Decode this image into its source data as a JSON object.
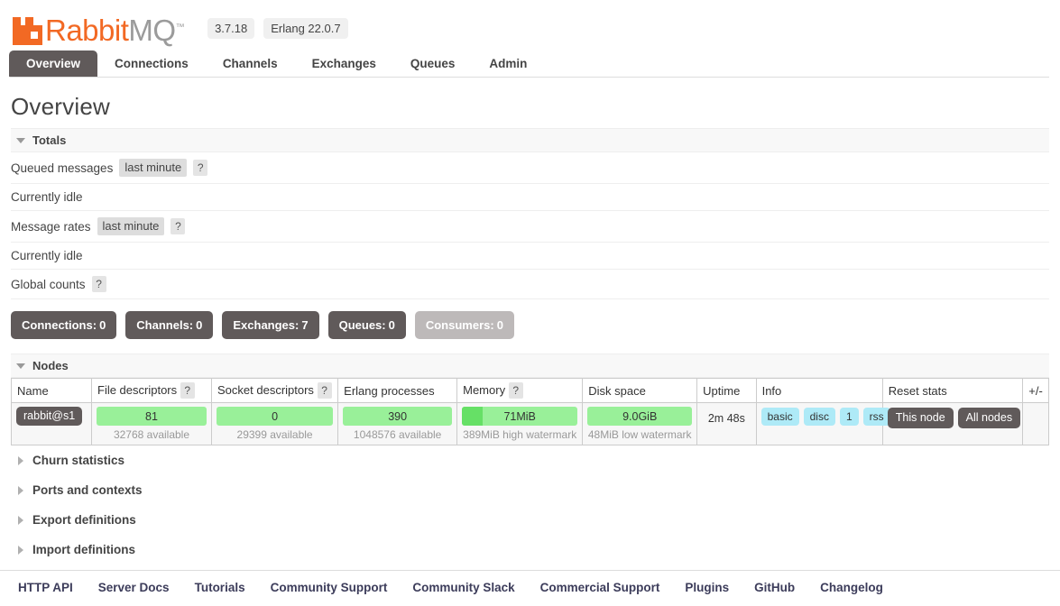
{
  "header": {
    "brand_rabbit": "Rabbit",
    "brand_mq": "MQ",
    "trademark": "™",
    "version": "3.7.18",
    "erlang_version": "Erlang 22.0.7"
  },
  "nav": {
    "tabs": [
      {
        "label": "Overview",
        "active": true
      },
      {
        "label": "Connections",
        "active": false
      },
      {
        "label": "Channels",
        "active": false
      },
      {
        "label": "Exchanges",
        "active": false
      },
      {
        "label": "Queues",
        "active": false
      },
      {
        "label": "Admin",
        "active": false
      }
    ]
  },
  "page": {
    "title": "Overview"
  },
  "totals": {
    "section_label": "Totals",
    "queued_messages_label": "Queued messages",
    "queued_messages_period": "last minute",
    "queued_messages_help": "?",
    "queued_messages_status": "Currently idle",
    "message_rates_label": "Message rates",
    "message_rates_period": "last minute",
    "message_rates_help": "?",
    "message_rates_status": "Currently idle",
    "global_counts_label": "Global counts",
    "global_counts_help": "?",
    "counts": [
      {
        "label": "Connections:",
        "value": "0",
        "disabled": false
      },
      {
        "label": "Channels:",
        "value": "0",
        "disabled": false
      },
      {
        "label": "Exchanges:",
        "value": "7",
        "disabled": false
      },
      {
        "label": "Queues:",
        "value": "0",
        "disabled": false
      },
      {
        "label": "Consumers:",
        "value": "0",
        "disabled": true
      }
    ]
  },
  "nodes": {
    "section_label": "Nodes",
    "columns": {
      "name": "Name",
      "file_descriptors": "File descriptors",
      "file_descriptors_help": "?",
      "socket_descriptors": "Socket descriptors",
      "socket_descriptors_help": "?",
      "erlang_processes": "Erlang processes",
      "memory": "Memory",
      "memory_help": "?",
      "disk_space": "Disk space",
      "uptime": "Uptime",
      "info": "Info",
      "reset_stats": "Reset stats",
      "plusminus": "+/-"
    },
    "row": {
      "name": "rabbit@s1",
      "file_descriptors_value": "81",
      "file_descriptors_sub": "32768 available",
      "file_descriptors_pct": 0,
      "socket_descriptors_value": "0",
      "socket_descriptors_sub": "29399 available",
      "socket_descriptors_pct": 0,
      "erlang_processes_value": "390",
      "erlang_processes_sub": "1048576 available",
      "erlang_processes_pct": 0,
      "memory_value": "71MiB",
      "memory_sub": "389MiB high watermark",
      "memory_pct": 18,
      "disk_space_value": "9.0GiB",
      "disk_space_sub": "48MiB low watermark",
      "disk_space_pct": 0,
      "uptime": "2m 48s",
      "info_badges": [
        "basic",
        "disc",
        "1",
        "rss"
      ],
      "reset_buttons": [
        "This node",
        "All nodes"
      ]
    }
  },
  "collapsed_sections": [
    {
      "label": "Churn statistics"
    },
    {
      "label": "Ports and contexts"
    },
    {
      "label": "Export definitions"
    },
    {
      "label": "Import definitions"
    }
  ],
  "footer": {
    "links": [
      "HTTP API",
      "Server Docs",
      "Tutorials",
      "Community Support",
      "Community Slack",
      "Commercial Support",
      "Plugins",
      "GitHub",
      "Changelog"
    ]
  },
  "colors": {
    "brand_orange": "#f26924",
    "dark_button": "#605a5a",
    "bar_green": "#99f099",
    "bar_fill_green": "#66e066",
    "info_badge": "#aeeaf7"
  }
}
